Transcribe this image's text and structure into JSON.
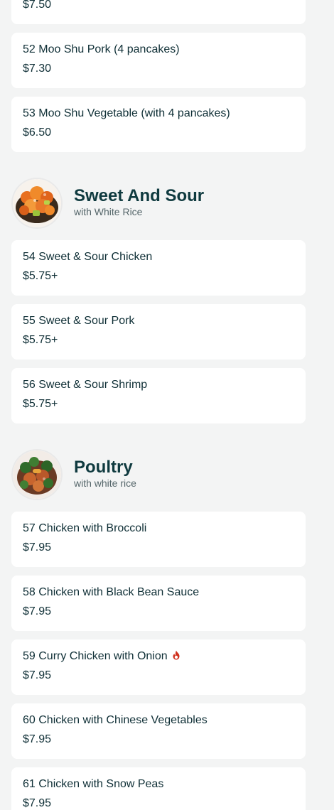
{
  "colors": {
    "background": "#f3f4f4",
    "card": "#ffffff",
    "text": "#0f2f36",
    "heading": "#0f3a3f",
    "spicy": "#d0311e"
  },
  "top_item": {
    "price": "$7.50"
  },
  "items_a": [
    {
      "name": "52 Moo Shu Pork (4 pancakes)",
      "price": "$7.30"
    },
    {
      "name": "53 Moo Shu Vegetable (with 4 pancakes)",
      "price": "$6.50"
    }
  ],
  "sweet_sour": {
    "title": "Sweet And Sour",
    "subtitle": "with White Rice",
    "image_icon": "sweet-and-sour-chicken-photo",
    "items": [
      {
        "name": "54 Sweet & Sour Chicken",
        "price": "$5.75+"
      },
      {
        "name": "55 Sweet & Sour Pork",
        "price": "$5.75+"
      },
      {
        "name": "56 Sweet & Sour Shrimp",
        "price": "$5.75+"
      }
    ]
  },
  "poultry": {
    "title": "Poultry",
    "subtitle": "with white rice",
    "image_icon": "chicken-broccoli-photo",
    "items": [
      {
        "name": "57 Chicken with Broccoli",
        "price": "$7.95"
      },
      {
        "name": "58 Chicken with Black Bean Sauce",
        "price": "$7.95"
      },
      {
        "name": "59 Curry Chicken with Onion",
        "price": "$7.95",
        "spicy": true,
        "icon": "spicy-flame-icon"
      },
      {
        "name": "60 Chicken with Chinese Vegetables",
        "price": "$7.95"
      },
      {
        "name": "61 Chicken with Snow Peas",
        "price": "$7.95"
      }
    ]
  }
}
